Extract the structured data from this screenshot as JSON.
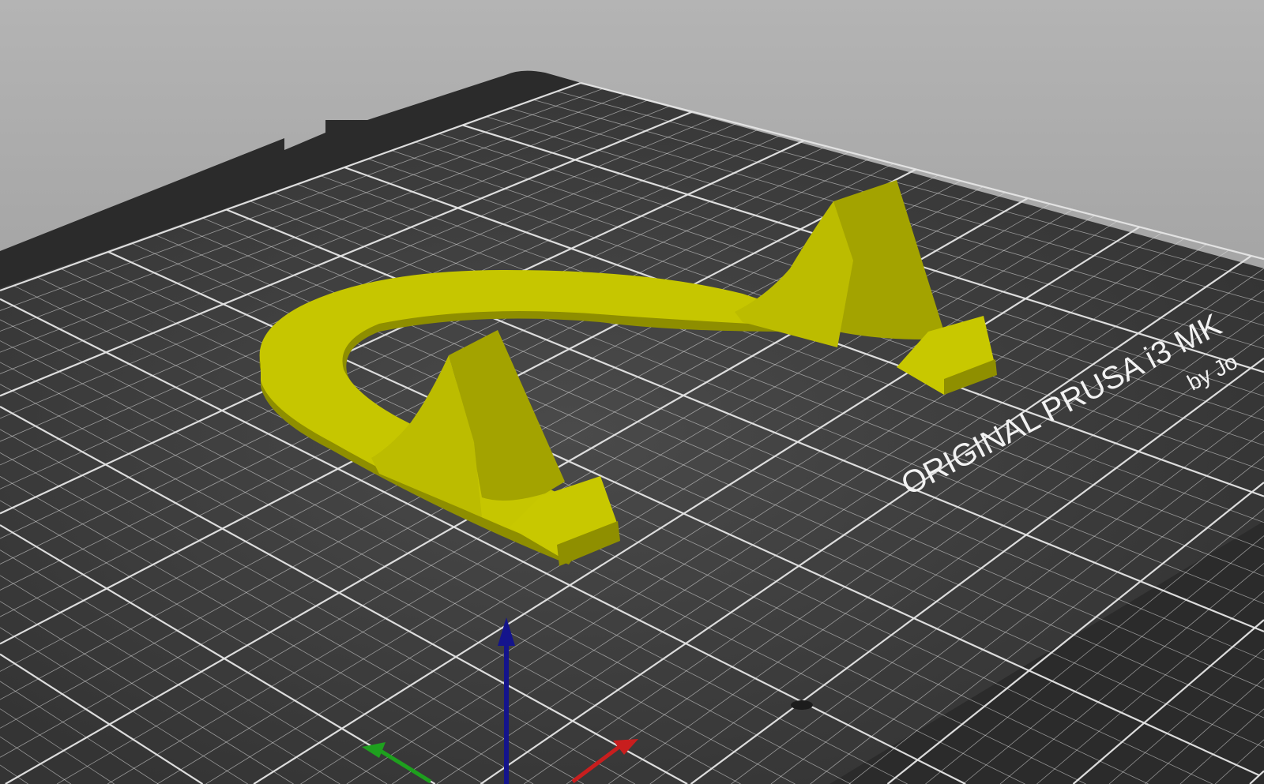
{
  "bed": {
    "label": "ORIGINAL PRUSA i3 MK",
    "sublabel": "by Jo",
    "surface_color": "#3a3a3a",
    "frame_color": "#2a2a2a",
    "grid_color": "#e6e6e6"
  },
  "model": {
    "color": "#c8c800"
  },
  "axes": {
    "x_color": "#c81e1e",
    "y_color": "#1ea01e",
    "z_color": "#14148c"
  }
}
